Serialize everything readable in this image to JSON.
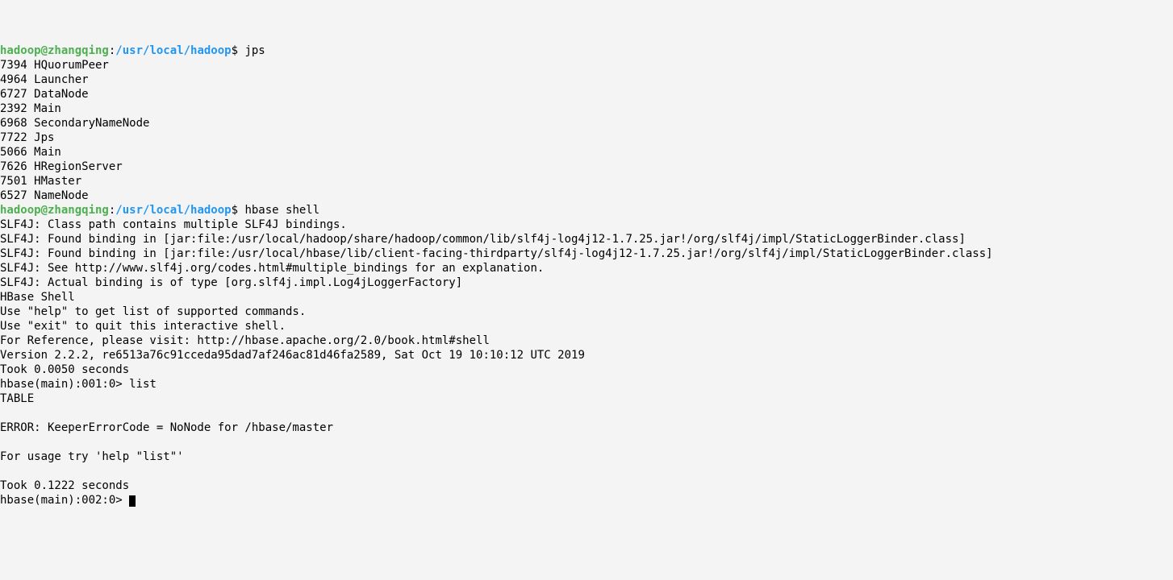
{
  "prompt1": {
    "user": "hadoop@zhangqing",
    "sep": ":",
    "path": "/usr/local/hadoop",
    "dollar": "$ ",
    "cmd": "jps"
  },
  "jps": [
    "7394 HQuorumPeer",
    "4964 Launcher",
    "6727 DataNode",
    "2392 Main",
    "6968 SecondaryNameNode",
    "7722 Jps",
    "5066 Main",
    "7626 HRegionServer",
    "7501 HMaster",
    "6527 NameNode"
  ],
  "prompt2": {
    "user": "hadoop@zhangqing",
    "sep": ":",
    "path": "/usr/local/hadoop",
    "dollar": "$ ",
    "cmd": "hbase shell"
  },
  "slf4j": [
    "SLF4J: Class path contains multiple SLF4J bindings.",
    "SLF4J: Found binding in [jar:file:/usr/local/hadoop/share/hadoop/common/lib/slf4j-log4j12-1.7.25.jar!/org/slf4j/impl/StaticLoggerBinder.class]",
    "SLF4J: Found binding in [jar:file:/usr/local/hbase/lib/client-facing-thirdparty/slf4j-log4j12-1.7.25.jar!/org/slf4j/impl/StaticLoggerBinder.class]",
    "SLF4J: See http://www.slf4j.org/codes.html#multiple_bindings for an explanation.",
    "SLF4J: Actual binding is of type [org.slf4j.impl.Log4jLoggerFactory]"
  ],
  "hbase_intro": [
    "HBase Shell",
    "Use \"help\" to get list of supported commands.",
    "Use \"exit\" to quit this interactive shell.",
    "For Reference, please visit: http://hbase.apache.org/2.0/book.html#shell",
    "Version 2.2.2, re6513a76c91cceda95dad7af246ac81d46fa2589, Sat Oct 19 10:10:12 UTC 2019",
    "Took 0.0050 seconds"
  ],
  "hbase_prompt1": {
    "prompt": "hbase(main):001:0> ",
    "cmd": "list"
  },
  "list_output": [
    "TABLE",
    "",
    "ERROR: KeeperErrorCode = NoNode for /hbase/master",
    "",
    "For usage try 'help \"list\"'",
    "",
    "Took 0.1222 seconds"
  ],
  "hbase_prompt2": {
    "prompt": "hbase(main):002:0> "
  }
}
